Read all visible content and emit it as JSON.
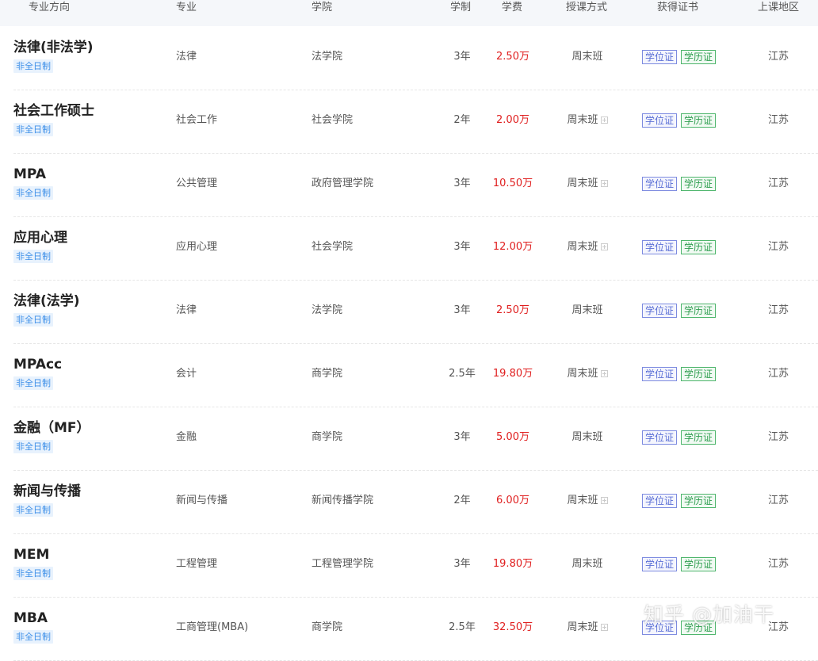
{
  "headers": {
    "direction": "专业方向",
    "major": "专业",
    "college": "学院",
    "duration": "学制",
    "fee": "学费",
    "mode": "授课方式",
    "certificate": "获得证书",
    "region": "上课地区"
  },
  "rows": [
    {
      "name": "法律(非法学)",
      "badge": "非全日制",
      "major": "法律",
      "college": "法学院",
      "duration": "3年",
      "fee": "2.50万",
      "mode": "周末班",
      "mode_expand": false,
      "cert_degree": "学位证",
      "cert_diploma": "学历证",
      "region": "江苏"
    },
    {
      "name": "社会工作硕士",
      "badge": "非全日制",
      "major": "社会工作",
      "college": "社会学院",
      "duration": "2年",
      "fee": "2.00万",
      "mode": "周末班",
      "mode_expand": true,
      "cert_degree": "学位证",
      "cert_diploma": "学历证",
      "region": "江苏"
    },
    {
      "name": "MPA",
      "badge": "非全日制",
      "major": "公共管理",
      "college": "政府管理学院",
      "duration": "3年",
      "fee": "10.50万",
      "mode": "周末班",
      "mode_expand": true,
      "cert_degree": "学位证",
      "cert_diploma": "学历证",
      "region": "江苏"
    },
    {
      "name": "应用心理",
      "badge": "非全日制",
      "major": "应用心理",
      "college": "社会学院",
      "duration": "3年",
      "fee": "12.00万",
      "mode": "周末班",
      "mode_expand": true,
      "cert_degree": "学位证",
      "cert_diploma": "学历证",
      "region": "江苏"
    },
    {
      "name": "法律(法学)",
      "badge": "非全日制",
      "major": "法律",
      "college": "法学院",
      "duration": "3年",
      "fee": "2.50万",
      "mode": "周末班",
      "mode_expand": false,
      "cert_degree": "学位证",
      "cert_diploma": "学历证",
      "region": "江苏"
    },
    {
      "name": "MPAcc",
      "badge": "非全日制",
      "major": "会计",
      "college": "商学院",
      "duration": "2.5年",
      "fee": "19.80万",
      "mode": "周末班",
      "mode_expand": true,
      "cert_degree": "学位证",
      "cert_diploma": "学历证",
      "region": "江苏"
    },
    {
      "name": "金融（MF）",
      "badge": "非全日制",
      "major": "金融",
      "college": "商学院",
      "duration": "3年",
      "fee": "5.00万",
      "mode": "周末班",
      "mode_expand": false,
      "cert_degree": "学位证",
      "cert_diploma": "学历证",
      "region": "江苏"
    },
    {
      "name": "新闻与传播",
      "badge": "非全日制",
      "major": "新闻与传播",
      "college": "新闻传播学院",
      "duration": "2年",
      "fee": "6.00万",
      "mode": "周末班",
      "mode_expand": true,
      "cert_degree": "学位证",
      "cert_diploma": "学历证",
      "region": "江苏"
    },
    {
      "name": "MEM",
      "badge": "非全日制",
      "major": "工程管理",
      "college": "工程管理学院",
      "duration": "3年",
      "fee": "19.80万",
      "mode": "周末班",
      "mode_expand": false,
      "cert_degree": "学位证",
      "cert_diploma": "学历证",
      "region": "江苏"
    },
    {
      "name": "MBA",
      "badge": "非全日制",
      "major": "工商管理(MBA)",
      "college": "商学院",
      "duration": "2.5年",
      "fee": "32.50万",
      "mode": "周末班",
      "mode_expand": true,
      "cert_degree": "学位证",
      "cert_diploma": "学历证",
      "region": "江苏"
    }
  ],
  "watermark": "知乎 @加油干",
  "colors": {
    "fee": "#e02020",
    "badge": "#3b8ee8",
    "degree": "#5a6fd6",
    "diploma": "#2e9e4f",
    "header_bg": "#f5f7fa"
  }
}
